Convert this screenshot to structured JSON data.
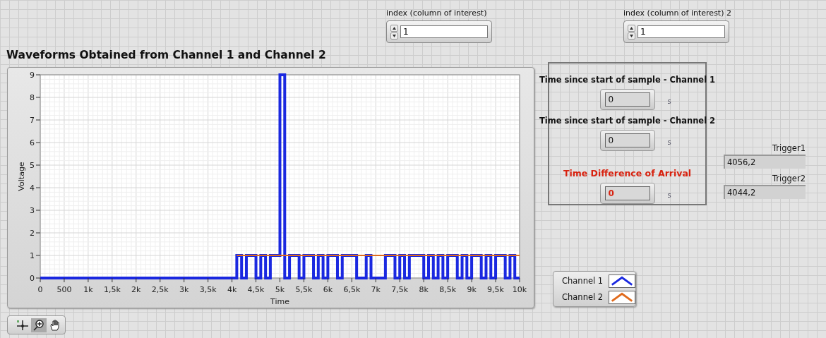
{
  "index_controls": [
    {
      "label": "index (column of interest)",
      "value": "1"
    },
    {
      "label": "index (column of interest) 2",
      "value": "1"
    }
  ],
  "graph": {
    "title": "Waveforms Obtained from Channel 1 and Channel 2",
    "chart_data": {
      "type": "line",
      "xlabel": "Time",
      "ylabel": "Voltage",
      "xlim": [
        0,
        10000
      ],
      "ylim": [
        0,
        9
      ],
      "grid": true,
      "x": [
        0,
        4100,
        4100,
        4200,
        4200,
        4300,
        4300,
        4400,
        4400,
        4500,
        4500,
        4600,
        4600,
        4700,
        4700,
        4800,
        4800,
        4900,
        4900,
        5000,
        5000,
        5100,
        5100,
        5200,
        5200,
        5300,
        5300,
        5400,
        5400,
        5500,
        5500,
        5600,
        5600,
        5700,
        5700,
        5800,
        5800,
        5900,
        5900,
        6000,
        6000,
        6100,
        6100,
        6200,
        6200,
        6300,
        6300,
        6400,
        6400,
        6500,
        6500,
        6600,
        6600,
        6700,
        6700,
        6800,
        6800,
        6900,
        6900,
        7000,
        7000,
        7100,
        7100,
        7200,
        7200,
        7300,
        7300,
        7400,
        7400,
        7500,
        7500,
        7600,
        7600,
        7700,
        7700,
        7800,
        7800,
        7900,
        7900,
        8000,
        8000,
        8100,
        8100,
        8200,
        8200,
        8300,
        8300,
        8400,
        8400,
        8500,
        8500,
        8600,
        8600,
        8700,
        8700,
        8800,
        8800,
        8900,
        8900,
        9000,
        9000,
        9100,
        9100,
        9200,
        9200,
        9300,
        9300,
        9400,
        9400,
        9500,
        9500,
        9600,
        9600,
        9700,
        9700,
        9800,
        9800,
        9900,
        9900,
        10000
      ],
      "series": [
        {
          "name": "Channel 1",
          "color": "#1a28e0",
          "values": [
            0,
            0,
            1,
            1,
            0,
            0,
            1,
            1,
            1,
            1,
            0,
            0,
            1,
            1,
            0,
            0,
            1,
            1,
            1,
            1,
            9,
            9,
            0,
            0,
            1,
            1,
            1,
            1,
            0,
            0,
            1,
            1,
            1,
            1,
            0,
            0,
            1,
            1,
            0,
            0,
            1,
            1,
            1,
            1,
            0,
            0,
            1,
            1,
            1,
            1,
            1,
            1,
            0,
            0,
            0,
            0,
            1,
            1,
            0,
            0,
            0,
            0,
            0,
            0,
            1,
            1,
            1,
            1,
            0,
            0,
            1,
            1,
            0,
            0,
            1,
            1,
            1,
            1,
            1,
            1,
            0,
            0,
            1,
            1,
            0,
            0,
            1,
            1,
            0,
            0,
            1,
            1,
            1,
            1,
            0,
            0,
            1,
            1,
            0,
            0,
            1,
            1,
            1,
            1,
            0,
            0,
            1,
            1,
            0,
            0,
            1,
            1,
            1,
            1,
            0,
            0,
            1,
            1,
            0,
            0
          ]
        },
        {
          "name": "Channel 2",
          "color": "#e06a1c",
          "values": [
            null,
            null,
            1,
            1,
            1,
            1,
            1,
            1,
            1,
            1,
            1,
            1,
            1,
            1,
            1,
            1,
            1,
            1,
            1,
            1,
            1,
            1,
            1,
            1,
            1,
            1,
            1,
            1,
            1,
            1,
            1,
            1,
            1,
            1,
            1,
            1,
            1,
            1,
            1,
            1,
            1,
            1,
            1,
            1,
            1,
            1,
            1,
            1,
            1,
            1,
            1,
            1,
            1,
            1,
            1,
            1,
            1,
            1,
            1,
            1,
            1,
            1,
            1,
            1,
            1,
            1,
            1,
            1,
            1,
            1,
            1,
            1,
            1,
            1,
            1,
            1,
            1,
            1,
            1,
            1,
            1,
            1,
            1,
            1,
            1,
            1,
            1,
            1,
            1,
            1,
            1,
            1,
            1,
            1,
            1,
            1,
            1,
            1,
            1,
            1,
            1,
            1,
            1,
            1,
            1,
            1,
            1,
            1,
            1,
            1,
            1,
            1,
            1,
            1,
            1,
            1,
            1,
            1,
            1,
            1
          ]
        }
      ],
      "xticks": [
        0,
        500,
        {
          "value": 1000,
          "label": "1k"
        },
        {
          "value": 1500,
          "label": "1,5k"
        },
        {
          "value": 2000,
          "label": "2k"
        },
        {
          "value": 2500,
          "label": "2,5k"
        },
        {
          "value": 3000,
          "label": "3k"
        },
        {
          "value": 3500,
          "label": "3,5k"
        },
        {
          "value": 4000,
          "label": "4k"
        },
        {
          "value": 4500,
          "label": "4,5k"
        },
        {
          "value": 5000,
          "label": "5k"
        },
        {
          "value": 5500,
          "label": "5,5k"
        },
        {
          "value": 6000,
          "label": "6k"
        },
        {
          "value": 6500,
          "label": "6,5k"
        },
        {
          "value": 7000,
          "label": "7k"
        },
        {
          "value": 7500,
          "label": "7,5k"
        },
        {
          "value": 8000,
          "label": "8k"
        },
        {
          "value": 8500,
          "label": "8,5k"
        },
        {
          "value": 9000,
          "label": "9k"
        },
        {
          "value": 9500,
          "label": "9,5k"
        },
        {
          "value": 10000,
          "label": "10k"
        }
      ],
      "yticks": [
        0,
        1,
        2,
        3,
        4,
        5,
        6,
        7,
        8,
        9
      ]
    }
  },
  "timing_panel": {
    "indicators": [
      {
        "label": "Time since start of sample - Channel 1",
        "value": "0",
        "unit": "s",
        "kind": "normal"
      },
      {
        "label": "Time since start of sample - Channel 2",
        "value": "0",
        "unit": "s",
        "kind": "normal"
      },
      {
        "label": "Time Difference of Arrival",
        "value": "0",
        "unit": "s",
        "kind": "alert"
      }
    ]
  },
  "triggers": [
    {
      "label": "Trigger1",
      "value": "4056,2"
    },
    {
      "label": "Trigger2",
      "value": "4044,2"
    }
  ]
}
